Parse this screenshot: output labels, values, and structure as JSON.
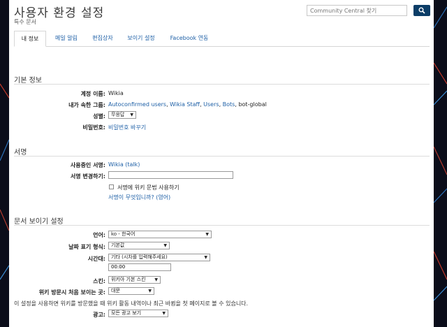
{
  "header": {
    "title": "사용자 환경 설정",
    "subtitle": "특수 문서",
    "search_placeholder": "Community Central 찾기",
    "search_icon": "magnifier-icon"
  },
  "tabs": [
    {
      "label": "내 정보",
      "active": true
    },
    {
      "label": "메일 알림",
      "active": false
    },
    {
      "label": "편집상자",
      "active": false
    },
    {
      "label": "보이기 설정",
      "active": false
    },
    {
      "label": "Facebook 연동",
      "active": false
    }
  ],
  "basic": {
    "section_title": "기본 정보",
    "username_label": "계정 이름:",
    "username_value": "Wikia",
    "groups_label": "내가 속한 그룹:",
    "groups": [
      "Autoconfirmed users",
      "Wikia Staff",
      "Users",
      "Bots"
    ],
    "groups_plain": "bot-global",
    "gender_label": "성별:",
    "gender_value": "무응답",
    "password_label": "비밀번호:",
    "password_link": "비밀번호 바꾸기"
  },
  "signature": {
    "section_title": "서명",
    "current_label": "사용중인 서명:",
    "current_name": "Wikia",
    "current_talk": "(talk)",
    "change_label": "서명 변경하기:",
    "change_value": "",
    "wikitext_checkbox": "서명에 위키 문법 사용하기",
    "help_link": "서명이 무엇입니까? (영어)"
  },
  "appearance": {
    "section_title": "문서 보이기 설정",
    "language_label": "언어:",
    "language_value": "ko - 한국어",
    "date_label": "날짜 표기 형식:",
    "date_value": "기본값",
    "timezone_label": "시간대:",
    "timezone_value": "기타 (시차를 입력해주세요)",
    "offset_value": "00:00",
    "skin_label": "스킨:",
    "skin_value": "위키아 기본 스킨",
    "landing_label": "위키 방문시 처음 보이는 곳:",
    "landing_value": "대문",
    "landing_note": "이 설정을 사용하면 위키를 방문했을 때 위키 활동 내역이나 최근 바뀜을 첫 페이지로 볼 수 있습니다.",
    "ads_label": "광고:",
    "ads_value": "모든 광고 보기"
  },
  "colors": {
    "link": "#1d5fa6",
    "search_button": "#0b3d67",
    "background": "#0b0d1a"
  }
}
